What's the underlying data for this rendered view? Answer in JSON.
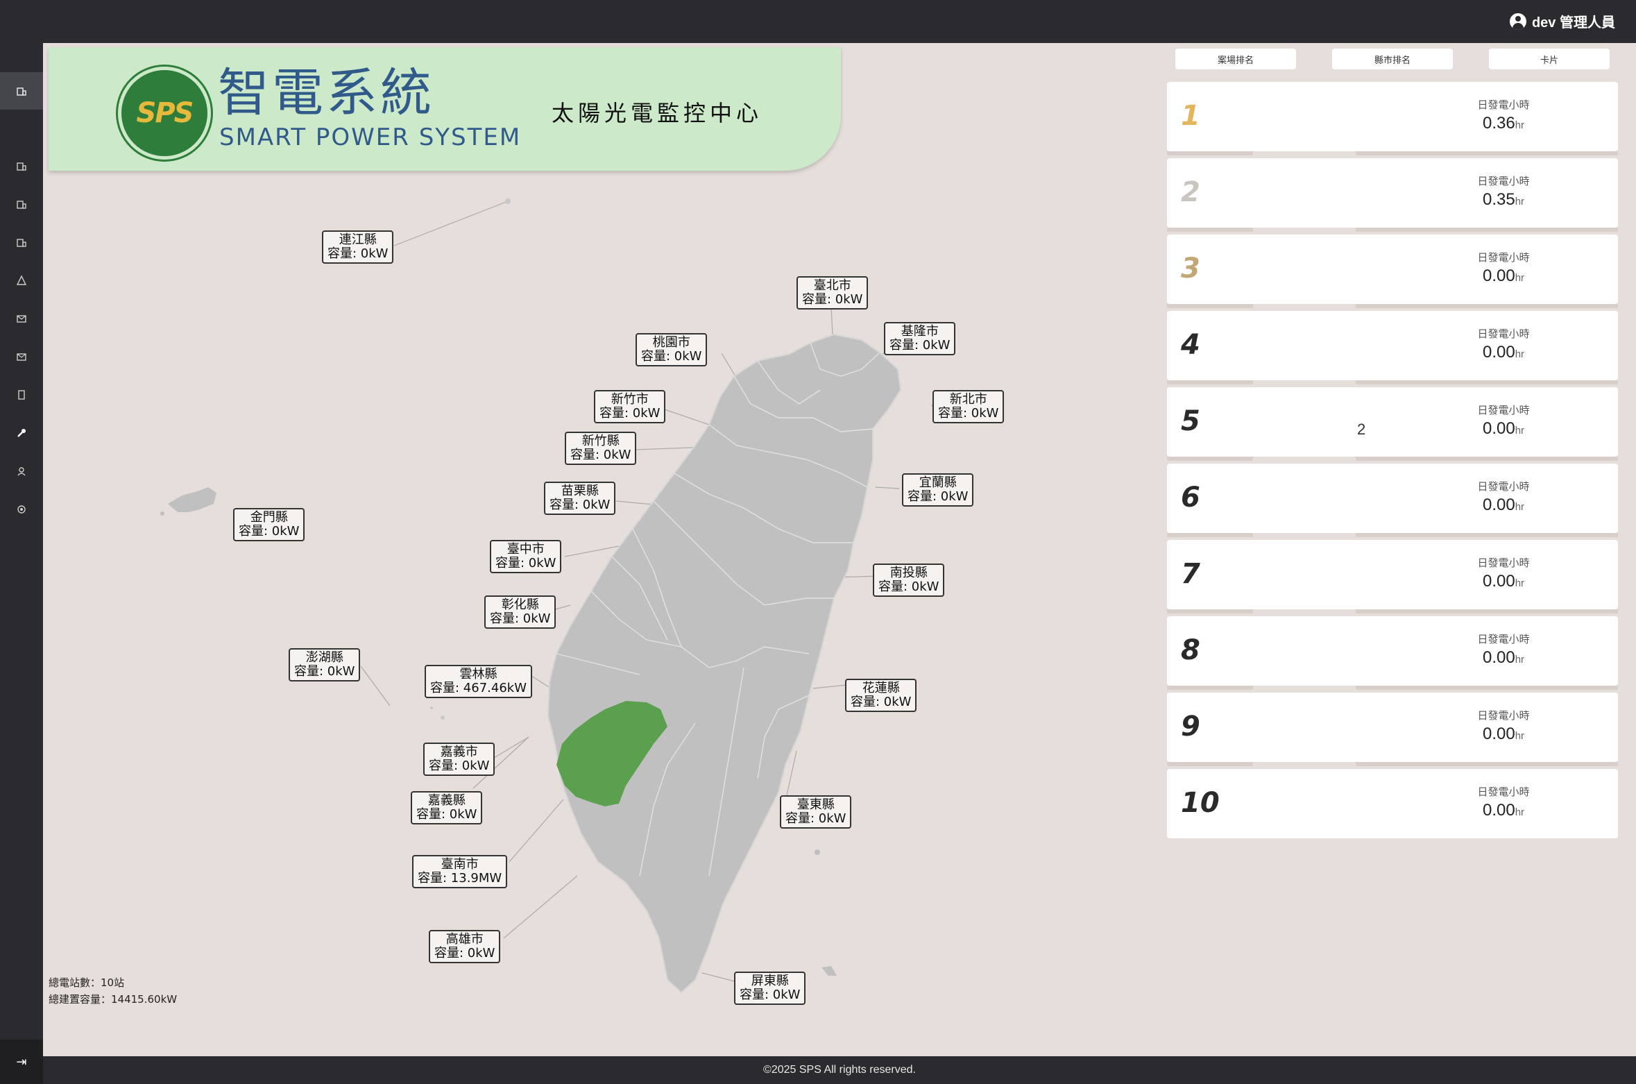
{
  "header": {
    "user_label": "dev 管理人員"
  },
  "brand": {
    "logo_text": "SPS",
    "cn": "智電系統",
    "en": "SMART POWER SYSTEM",
    "center_title": "太陽光電監控中心"
  },
  "tabs": [
    "案場排名",
    "縣市排名",
    "卡片"
  ],
  "ranking": [
    {
      "rank": "1",
      "label": "日發電小時",
      "value": "0.36",
      "unit": "hr",
      "mid": "",
      "color": "#e3b55c"
    },
    {
      "rank": "2",
      "label": "日發電小時",
      "value": "0.35",
      "unit": "hr",
      "mid": "",
      "color": "#c9c6bf"
    },
    {
      "rank": "3",
      "label": "日發電小時",
      "value": "0.00",
      "unit": "hr",
      "mid": "",
      "color": "#c2a877"
    },
    {
      "rank": "4",
      "label": "日發電小時",
      "value": "0.00",
      "unit": "hr",
      "mid": "",
      "color": "#2a2a2a"
    },
    {
      "rank": "5",
      "label": "日發電小時",
      "value": "0.00",
      "unit": "hr",
      "mid": "2",
      "color": "#2a2a2a"
    },
    {
      "rank": "6",
      "label": "日發電小時",
      "value": "0.00",
      "unit": "hr",
      "mid": "",
      "color": "#2a2a2a"
    },
    {
      "rank": "7",
      "label": "日發電小時",
      "value": "0.00",
      "unit": "hr",
      "mid": "",
      "color": "#2a2a2a"
    },
    {
      "rank": "8",
      "label": "日發電小時",
      "value": "0.00",
      "unit": "hr",
      "mid": "",
      "color": "#2a2a2a"
    },
    {
      "rank": "9",
      "label": "日發電小時",
      "value": "0.00",
      "unit": "hr",
      "mid": "",
      "color": "#2a2a2a"
    },
    {
      "rank": "10",
      "label": "日發電小時",
      "value": "0.00",
      "unit": "hr",
      "mid": "",
      "color": "#2a2a2a"
    }
  ],
  "counties": {
    "lienchiang": {
      "name": "連江縣",
      "cap": "容量: 0kW"
    },
    "kinmen": {
      "name": "金門縣",
      "cap": "容量: 0kW"
    },
    "penghu": {
      "name": "澎湖縣",
      "cap": "容量: 0kW"
    },
    "taipei": {
      "name": "臺北市",
      "cap": "容量: 0kW"
    },
    "keelung": {
      "name": "基隆市",
      "cap": "容量: 0kW"
    },
    "taoyuan": {
      "name": "桃園市",
      "cap": "容量: 0kW"
    },
    "newtaipei": {
      "name": "新北市",
      "cap": "容量: 0kW"
    },
    "hsinchucity": {
      "name": "新竹市",
      "cap": "容量: 0kW"
    },
    "hsinchucounty": {
      "name": "新竹縣",
      "cap": "容量: 0kW"
    },
    "yilan": {
      "name": "宜蘭縣",
      "cap": "容量: 0kW"
    },
    "miaoli": {
      "name": "苗栗縣",
      "cap": "容量: 0kW"
    },
    "taichung": {
      "name": "臺中市",
      "cap": "容量: 0kW"
    },
    "nantou": {
      "name": "南投縣",
      "cap": "容量: 0kW"
    },
    "changhua": {
      "name": "彰化縣",
      "cap": "容量: 0kW"
    },
    "yunlin": {
      "name": "雲林縣",
      "cap": "容量: 467.46kW"
    },
    "hualien": {
      "name": "花蓮縣",
      "cap": "容量: 0kW"
    },
    "chiayicity": {
      "name": "嘉義市",
      "cap": "容量: 0kW"
    },
    "chiayicounty": {
      "name": "嘉義縣",
      "cap": "容量: 0kW"
    },
    "taitung": {
      "name": "臺東縣",
      "cap": "容量: 0kW"
    },
    "tainan": {
      "name": "臺南市",
      "cap": "容量: 13.9MW"
    },
    "kaohsiung": {
      "name": "高雄市",
      "cap": "容量: 0kW"
    },
    "pingtung": {
      "name": "屏東縣",
      "cap": "容量: 0kW"
    }
  },
  "stats": {
    "stations": "總電站數：10站",
    "capacity": "總建置容量：14415.60kW"
  },
  "footer": {
    "copyright": "©2025 SPS All rights reserved."
  },
  "colors": {
    "highlight": "#5ba04e",
    "land": "#c0c0c0",
    "background": "#e6deda"
  },
  "sidebar_icons": [
    "building-icon",
    "building-icon",
    "building-icon",
    "building-icon",
    "building-icon",
    "warning-icon",
    "mail-icon",
    "mail-icon",
    "document-icon",
    "wrench-icon",
    "user-icon",
    "settings-icon"
  ]
}
